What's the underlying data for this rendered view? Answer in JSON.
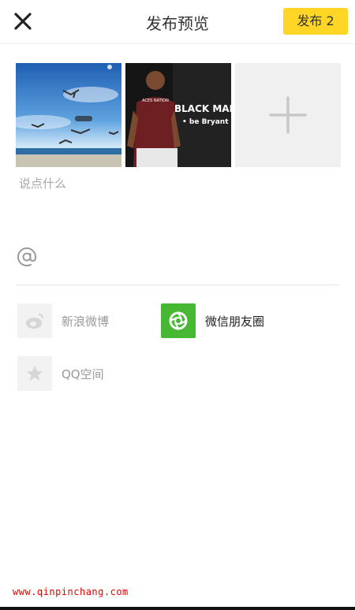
{
  "header": {
    "title": "发布预览",
    "publish_label": "发布 2",
    "close_icon": "close-icon",
    "accent_color": "#ffd526"
  },
  "photos": [
    {
      "name": "seagulls-beach-photo"
    },
    {
      "name": "basketball-player-photo",
      "text_lines": [
        "BLACK MAM",
        "• be Bryant"
      ]
    }
  ],
  "add_photo": {
    "icon": "plus-icon"
  },
  "caption": {
    "placeholder": "说点什么",
    "value": ""
  },
  "mention": {
    "icon": "at-icon"
  },
  "share_options": [
    {
      "label": "新浪微博",
      "icon": "weibo-icon",
      "selected": false
    },
    {
      "label": "微信朋友圈",
      "icon": "wechat-moments-icon",
      "selected": true,
      "color": "#46b833"
    },
    {
      "label": "QQ空间",
      "icon": "qzone-star-icon",
      "selected": false
    }
  ],
  "watermark": "www.qinpinchang.com"
}
